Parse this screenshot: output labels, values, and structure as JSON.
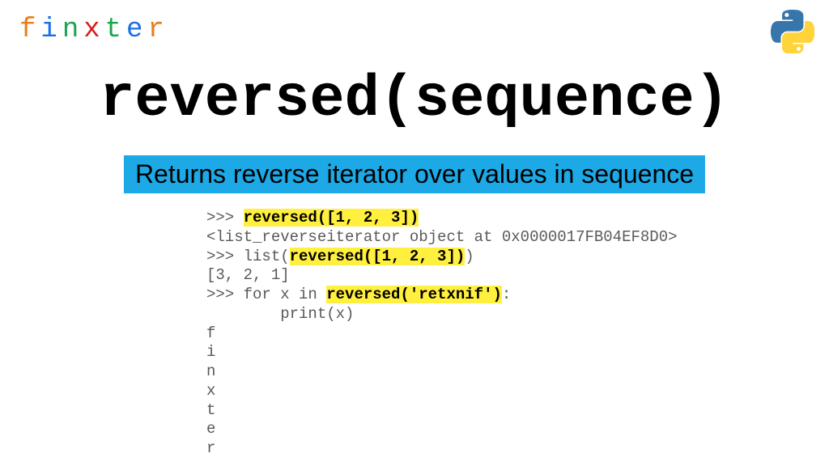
{
  "logo": {
    "letters": [
      {
        "char": "f",
        "color": "#e87d1a"
      },
      {
        "char": "i",
        "color": "#1a6fe8"
      },
      {
        "char": "n",
        "color": "#1aa64d"
      },
      {
        "char": "x",
        "color": "#d91a1a"
      },
      {
        "char": "t",
        "color": "#1aa64d"
      },
      {
        "char": "e",
        "color": "#1a6fe8"
      },
      {
        "char": "r",
        "color": "#e87d1a"
      }
    ]
  },
  "title": "reversed(sequence)",
  "subtitle": "Returns reverse iterator over values in sequence",
  "code": {
    "line1_prompt": ">>> ",
    "line1_hl": "reversed([1, 2, 3])",
    "line2": "<list_reverseiterator object at 0x0000017FB04EF8D0>",
    "line3_prompt": ">>> list(",
    "line3_hl": "reversed([1, 2, 3])",
    "line3_tail": ")",
    "line4": "[3, 2, 1]",
    "line5_prompt": ">>> for x in ",
    "line5_hl": "reversed('retxnif')",
    "line5_tail": ":",
    "line6": "        print(x)",
    "out1": "f",
    "out2": "i",
    "out3": "n",
    "out4": "x",
    "out5": "t",
    "out6": "e",
    "out7": "r"
  }
}
